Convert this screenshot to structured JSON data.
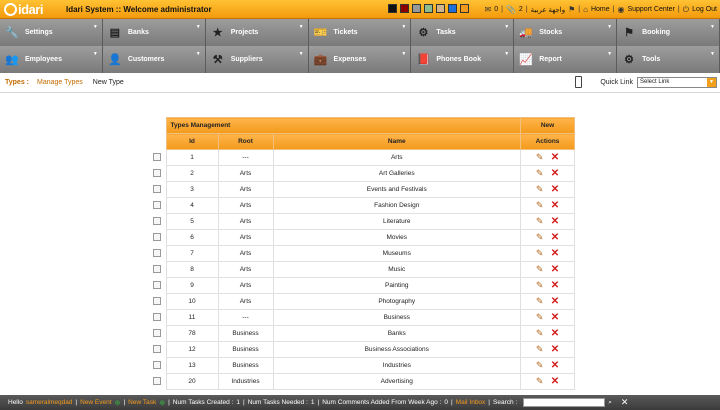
{
  "app": {
    "logo_text": "idari",
    "title": "Idari System :: Welcome administrator"
  },
  "swatches": [
    "#111111",
    "#8b0000",
    "#999999",
    "#8fbc8f",
    "#d2b48c",
    "#1e6fd9",
    "#f39a1c"
  ],
  "top_links": {
    "mail_count": "0",
    "attachment_count": "2",
    "language": "واجهة عربية",
    "home": "Home",
    "support": "Support Center",
    "logout": "Log Out"
  },
  "menu": {
    "row1": [
      {
        "label": "Settings",
        "icon": "wrench-icon",
        "glyph": "🔧"
      },
      {
        "label": "Banks",
        "icon": "bank-icon",
        "glyph": "▤"
      },
      {
        "label": "Projects",
        "icon": "star-icon",
        "glyph": "★"
      },
      {
        "label": "Tickets",
        "icon": "ticket-icon",
        "glyph": "🎫"
      },
      {
        "label": "Tasks",
        "icon": "network-icon",
        "glyph": "⚙"
      },
      {
        "label": "Stocks",
        "icon": "truck-icon",
        "glyph": "🚚"
      },
      {
        "label": "Booking",
        "icon": "flag-icon",
        "glyph": "⚑"
      }
    ],
    "row2": [
      {
        "label": "Employees",
        "icon": "users-icon",
        "glyph": "👥"
      },
      {
        "label": "Customers",
        "icon": "customers-icon",
        "glyph": "👤"
      },
      {
        "label": "Suppliers",
        "icon": "suppliers-icon",
        "glyph": "⚒"
      },
      {
        "label": "Expenses",
        "icon": "briefcase-icon",
        "glyph": "💼"
      },
      {
        "label": "Phones Book",
        "icon": "book-icon",
        "glyph": "📕"
      },
      {
        "label": "Report",
        "icon": "chart-icon",
        "glyph": "📈"
      },
      {
        "label": "Tools",
        "icon": "gears-icon",
        "glyph": "⚙"
      }
    ]
  },
  "breadcrumb": {
    "title": "Types :",
    "manage": "Manage Types",
    "new": "New Type"
  },
  "quick_link": {
    "label": "Quick Link",
    "selected": "Select Link"
  },
  "table": {
    "title": "Types Management",
    "new_label": "New",
    "columns": [
      "Id",
      "Root",
      "Name",
      "Actions"
    ],
    "rows": [
      {
        "id": "1",
        "root": "---",
        "name": "Arts"
      },
      {
        "id": "2",
        "root": "Arts",
        "name": "Art Galleries"
      },
      {
        "id": "3",
        "root": "Arts",
        "name": "Events and Festivals"
      },
      {
        "id": "4",
        "root": "Arts",
        "name": "Fashion Design"
      },
      {
        "id": "5",
        "root": "Arts",
        "name": "Literature"
      },
      {
        "id": "6",
        "root": "Arts",
        "name": "Movies"
      },
      {
        "id": "7",
        "root": "Arts",
        "name": "Museums"
      },
      {
        "id": "8",
        "root": "Arts",
        "name": "Music"
      },
      {
        "id": "9",
        "root": "Arts",
        "name": "Painting"
      },
      {
        "id": "10",
        "root": "Arts",
        "name": "Photography"
      },
      {
        "id": "11",
        "root": "---",
        "name": "Business"
      },
      {
        "id": "78",
        "root": "Business",
        "name": "Banks"
      },
      {
        "id": "12",
        "root": "Business",
        "name": "Business Associations"
      },
      {
        "id": "13",
        "root": "Business",
        "name": "Industries"
      },
      {
        "id": "20",
        "root": "Industries",
        "name": "Advertising"
      }
    ]
  },
  "footer": {
    "hello": "Hello",
    "user": "sameralmeqdad",
    "new_event": "New Event",
    "new_task": "New Task",
    "tasks_created_label": "Num Tasks Created :",
    "tasks_created": "1",
    "tasks_needed_label": "Num Tasks Needed :",
    "tasks_needed": "1",
    "comments_label": "Num Comments Added From Week Ago :",
    "comments": "0",
    "mail_inbox": "Mail Inbox",
    "search_label": "Search :"
  }
}
